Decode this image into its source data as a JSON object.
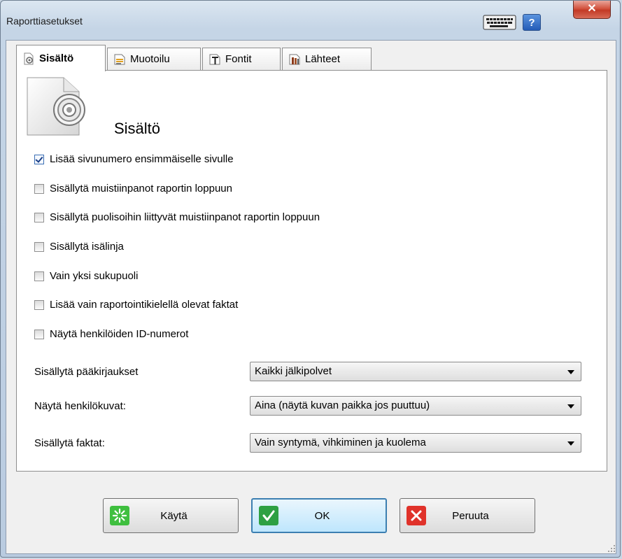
{
  "window": {
    "title": "Raporttiasetukset"
  },
  "titlebar": {
    "keyboard_icon": "keyboard-icon",
    "help_label": "?",
    "close_label": "x"
  },
  "tabs": [
    {
      "label": "Sisältö",
      "icon": "gear-document-icon",
      "active": true
    },
    {
      "label": "Muotoilu",
      "icon": "format-icon",
      "active": false
    },
    {
      "label": "Fontit",
      "icon": "font-icon",
      "active": false
    },
    {
      "label": "Lähteet",
      "icon": "sources-icon",
      "active": false
    }
  ],
  "content": {
    "heading": "Sisältö",
    "checkboxes": [
      {
        "label": "Lisää sivunumero ensimmäiselle sivulle",
        "checked": true
      },
      {
        "label": "Sisällytä muistiinpanot raportin loppuun",
        "checked": false
      },
      {
        "label": "Sisällytä puolisoihin liittyvät muistiinpanot raportin loppuun",
        "checked": false
      },
      {
        "label": "Sisällytä isälinja",
        "checked": false
      },
      {
        "label": "Vain yksi sukupuoli",
        "checked": false
      },
      {
        "label": "Lisää vain raportointikielellä olevat faktat",
        "checked": false
      },
      {
        "label": "Näytä henkilöiden ID-numerot",
        "checked": false
      }
    ],
    "dropdowns": [
      {
        "label": "Sisällytä pääkirjaukset",
        "value": "Kaikki jälkipolvet"
      },
      {
        "label": "Näytä henkilökuvat:",
        "value": "Aina (näytä kuvan paikka jos puuttuu)"
      },
      {
        "label": "Sisällytä faktat:",
        "value": "Vain syntymä, vihkiminen ja kuolema"
      }
    ]
  },
  "buttons": {
    "apply": "Käytä",
    "ok": "OK",
    "cancel": "Peruuta"
  },
  "colors": {
    "ok_green": "#2ea043",
    "cancel_red": "#e0322a",
    "apply_green": "#3fbf3f",
    "help_blue": "#2f6fd0"
  }
}
